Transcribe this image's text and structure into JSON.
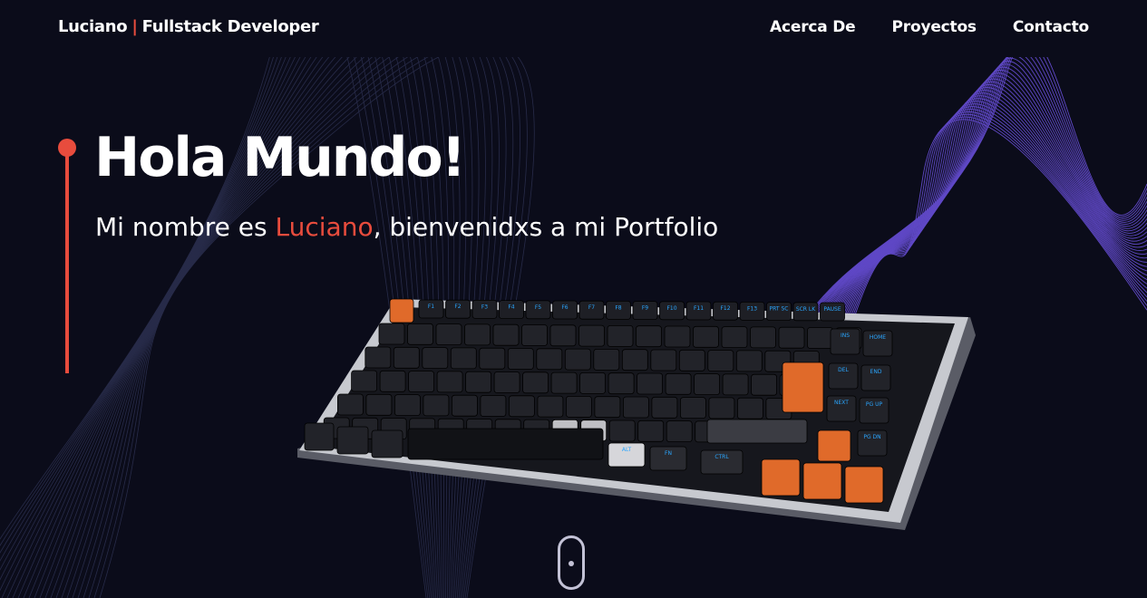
{
  "header": {
    "brand_name": "Luciano",
    "brand_separator": "|",
    "brand_role": "Fullstack Developer"
  },
  "nav": {
    "items": [
      {
        "label": "Acerca De"
      },
      {
        "label": "Proyectos"
      },
      {
        "label": "Contacto"
      }
    ]
  },
  "hero": {
    "title": "Hola Mundo!",
    "subtitle_before": "Mi nombre es ",
    "subtitle_name": "Luciano",
    "subtitle_after": ", bienvenidxs a mi Portfolio"
  },
  "keyboard": {
    "function_row": [
      "F1",
      "F2",
      "F3",
      "F4",
      "F5",
      "F6",
      "F7",
      "F8",
      "F9",
      "F10",
      "F11",
      "F12",
      "F13",
      "PRT SC",
      "SCR LK",
      "PAUSE"
    ],
    "nav_keys": [
      "INS",
      "HOME",
      "DEL",
      "END",
      "NEXT",
      "PG UP",
      "PG DN"
    ],
    "bottom_keys": [
      "ALT",
      "FN",
      "CTRL"
    ]
  },
  "colors": {
    "background": "#0b0c1a",
    "accent": "#e84c3d",
    "wave": "#7b5cff",
    "key_orange": "#e06a2a",
    "key_legend": "#2aa6ff"
  },
  "icons": {
    "scroll_indicator": "mouse-scroll-icon"
  }
}
